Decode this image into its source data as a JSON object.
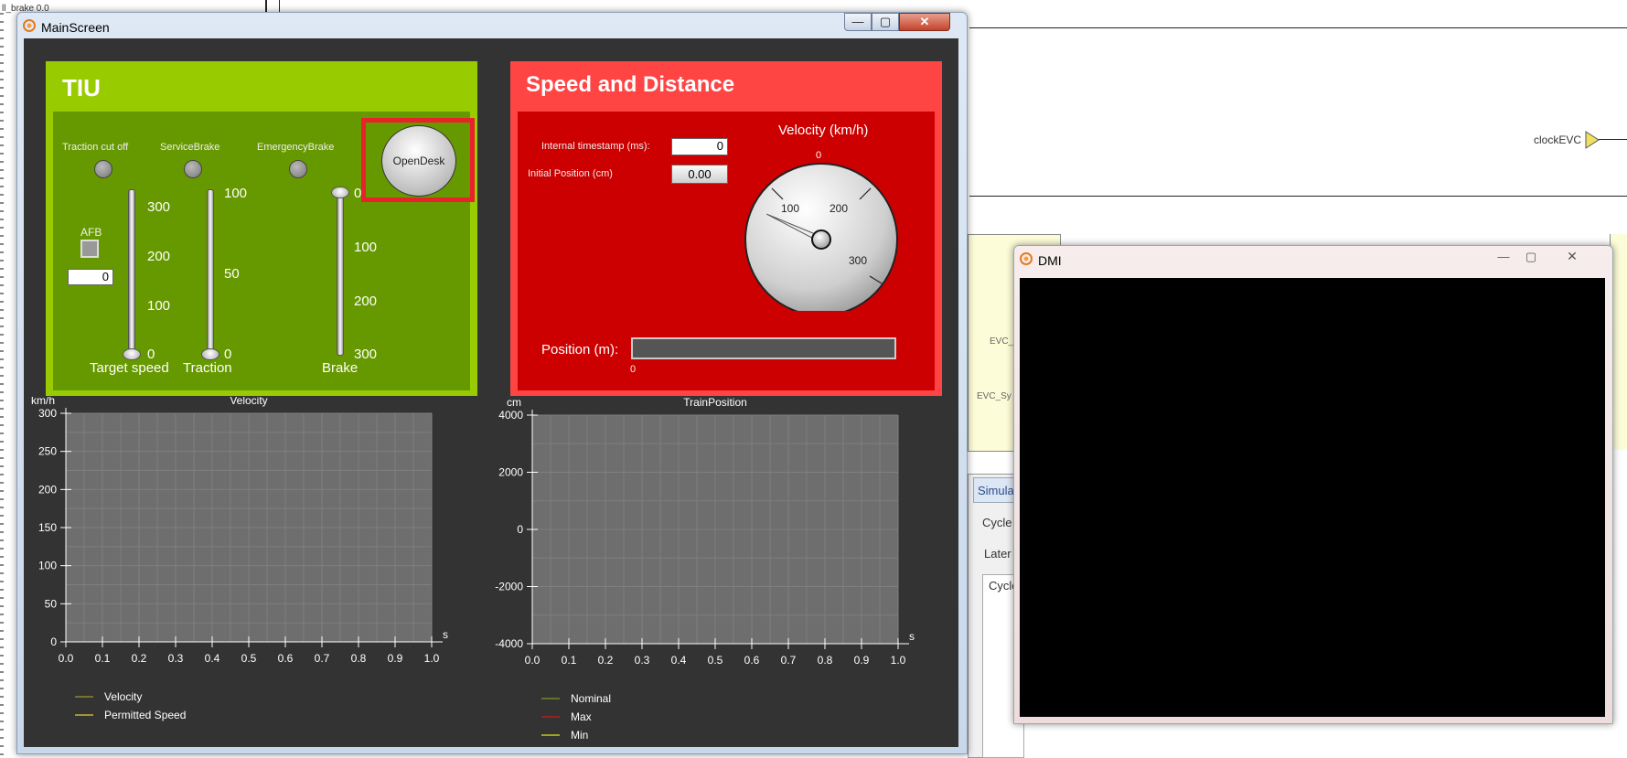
{
  "background": {
    "top_text": "ll_brake 0.0",
    "clock_label": "clockEVC",
    "side_labels": [
      "EVC_",
      "EVC_Sy"
    ],
    "tab_label": "Simula",
    "cycle_label": "Cycle",
    "later_label": "Later",
    "cycle_label2": "Cycle"
  },
  "mainscreen": {
    "title": "MainScreen",
    "tiu": {
      "title": "TIU",
      "traction_cut_off": "Traction cut off",
      "service_brake": "ServiceBrake",
      "emergency_brake": "EmergencyBrake",
      "open_desk": "OpenDesk",
      "afb_label": "AFB",
      "afb_value": "0",
      "target_speed_label": "Target speed",
      "traction_label": "Traction",
      "brake_label": "Brake",
      "target_speed_ticks": [
        "300",
        "200",
        "100",
        "0"
      ],
      "traction_ticks": [
        "100",
        "50",
        "0"
      ],
      "brake_ticks": [
        "0",
        "100",
        "200",
        "300"
      ]
    },
    "speed_distance": {
      "title": "Speed and Distance",
      "timestamp_label": "Internal timestamp (ms):",
      "timestamp_value": "0",
      "initial_position_label": "Initial Position (cm)",
      "initial_position_value": "0.00",
      "velocity_label": "Velocity (km/h)",
      "gauge_ticks": [
        "0",
        "100",
        "200",
        "300"
      ],
      "gauge_value": 0,
      "position_label": "Position (m):",
      "position_value": "0",
      "position_progress": 0
    }
  },
  "dmi": {
    "title": "DMI"
  },
  "chart_data": [
    {
      "type": "line",
      "title": "Velocity",
      "ylabel": "km/h",
      "xlabel": "s",
      "xlim": [
        0.0,
        1.0
      ],
      "ylim": [
        0,
        300
      ],
      "x_ticks": [
        "0.0",
        "0.1",
        "0.2",
        "0.3",
        "0.4",
        "0.5",
        "0.6",
        "0.7",
        "0.8",
        "0.9",
        "1.0"
      ],
      "y_ticks": [
        "0",
        "50",
        "100",
        "150",
        "200",
        "250",
        "300"
      ],
      "grid": true,
      "legend": "bottom-left",
      "series": [
        {
          "name": "Velocity",
          "color": "#8a8a2a",
          "x": [],
          "y": []
        },
        {
          "name": "Permitted Speed",
          "color": "#c8b43a",
          "x": [],
          "y": []
        }
      ]
    },
    {
      "type": "line",
      "title": "TrainPosition",
      "ylabel": "cm",
      "xlabel": "s",
      "xlim": [
        0.0,
        1.0
      ],
      "ylim": [
        -4000,
        4000
      ],
      "x_ticks": [
        "0.0",
        "0.1",
        "0.2",
        "0.3",
        "0.4",
        "0.5",
        "0.6",
        "0.7",
        "0.8",
        "0.9",
        "1.0"
      ],
      "y_ticks": [
        "-4000",
        "-2000",
        "0",
        "2000",
        "4000"
      ],
      "grid": true,
      "legend": "bottom-left",
      "series": [
        {
          "name": "Nominal",
          "color": "#6e8a2a",
          "x": [],
          "y": []
        },
        {
          "name": "Max",
          "color": "#b02020",
          "x": [],
          "y": []
        },
        {
          "name": "Min",
          "color": "#c8c820",
          "x": [],
          "y": []
        }
      ]
    }
  ],
  "colors": {
    "tiu_header": "#99cc00",
    "tiu_body": "#669900",
    "sd_header": "#ff4444",
    "sd_body": "#cc0000",
    "client_bg": "#333333",
    "plot_bg": "#6e6e6e",
    "highlight": "#e8212b"
  }
}
